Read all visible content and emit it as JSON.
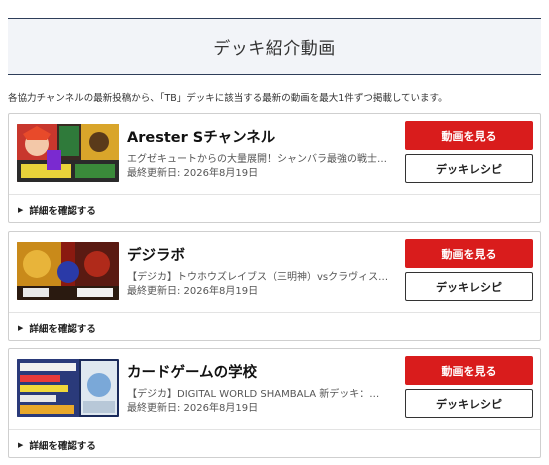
{
  "header": {
    "title": "デッキ紹介動画"
  },
  "description": "各協力チャンネルの最新投稿から、「TB」デッキに該当する最新の動画を最大1件ずつ掲載しています。",
  "cards": [
    {
      "channel": "Arester Sチャンネル",
      "video_title": "エグゼキュートからの大量展開！シャンバラ最強の戦士…",
      "updated": "最終更新日: 2026年8月19日",
      "watch_label": "動画を見る",
      "recipe_label": "デッキレシピ",
      "details_label": "詳細を確認する"
    },
    {
      "channel": "デジラボ",
      "video_title": "【デジカ】トウホウズレイブス（三明神）vsクラヴィス…",
      "updated": "最終更新日: 2026年8月19日",
      "watch_label": "動画を見る",
      "recipe_label": "デッキレシピ",
      "details_label": "詳細を確認する"
    },
    {
      "channel": "カードゲームの学校",
      "video_title": "【デジカ】DIGITAL WORLD SHAMBALA 新デッキ：…",
      "updated": "最終更新日: 2026年8月19日",
      "watch_label": "動画を見る",
      "recipe_label": "デッキレシピ",
      "details_label": "詳細を確認する"
    }
  ],
  "colors": {
    "watch_button": "#d91c1c",
    "header_border": "#2e3e59",
    "header_bg": "#f2f4f8"
  }
}
